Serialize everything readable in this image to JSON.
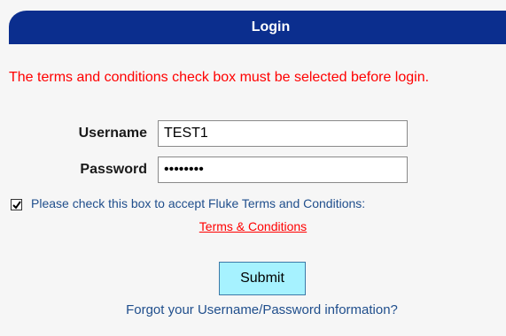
{
  "header": {
    "title": "Login"
  },
  "error_message": "The terms and conditions check box must be selected before login.",
  "form": {
    "username_label": "Username",
    "username_value": "TEST1",
    "password_label": "Password",
    "password_value": "secretpw"
  },
  "terms": {
    "checked": true,
    "text": "Please check this box to accept Fluke Terms and Conditions:",
    "link_label": "Terms & Conditions"
  },
  "submit_label": "Submit",
  "forgot_label": "Forgot your Username/Password information?",
  "colors": {
    "header_bg": "#0b2e8e",
    "error_text": "#ff0000",
    "link_blue": "#1f4e8c",
    "submit_bg": "#a6f2ff"
  }
}
